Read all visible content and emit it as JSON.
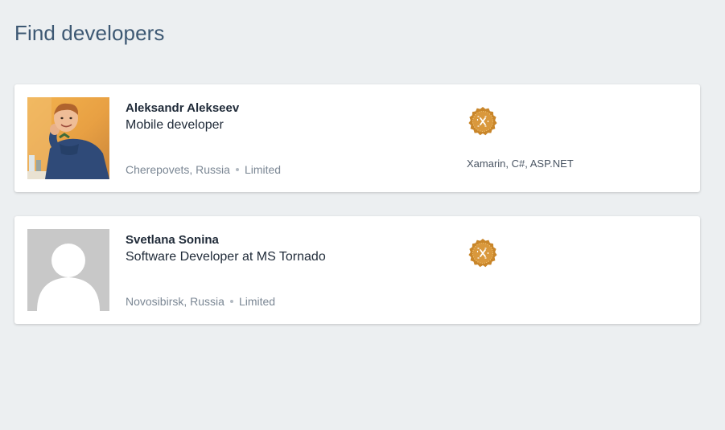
{
  "page": {
    "title": "Find developers"
  },
  "developers": [
    {
      "name": "Aleksandr Alekseev",
      "role": "Mobile developer",
      "location": "Cherepovets, Russia",
      "availability": "Limited",
      "skills": "Xamarin, C#, ASP.NET",
      "avatar": "user-photo",
      "badge": "xamarin-certified-badge-icon"
    },
    {
      "name": "Svetlana Sonina",
      "role": "Software Developer at MS Tornado",
      "location": "Novosibirsk, Russia",
      "availability": "Limited",
      "skills": "",
      "avatar": "default-avatar-placeholder",
      "badge": "xamarin-certified-badge-icon"
    }
  ],
  "colors": {
    "background": "#eceff1",
    "title": "#3d5873",
    "badge_gold": "#c9862a"
  }
}
